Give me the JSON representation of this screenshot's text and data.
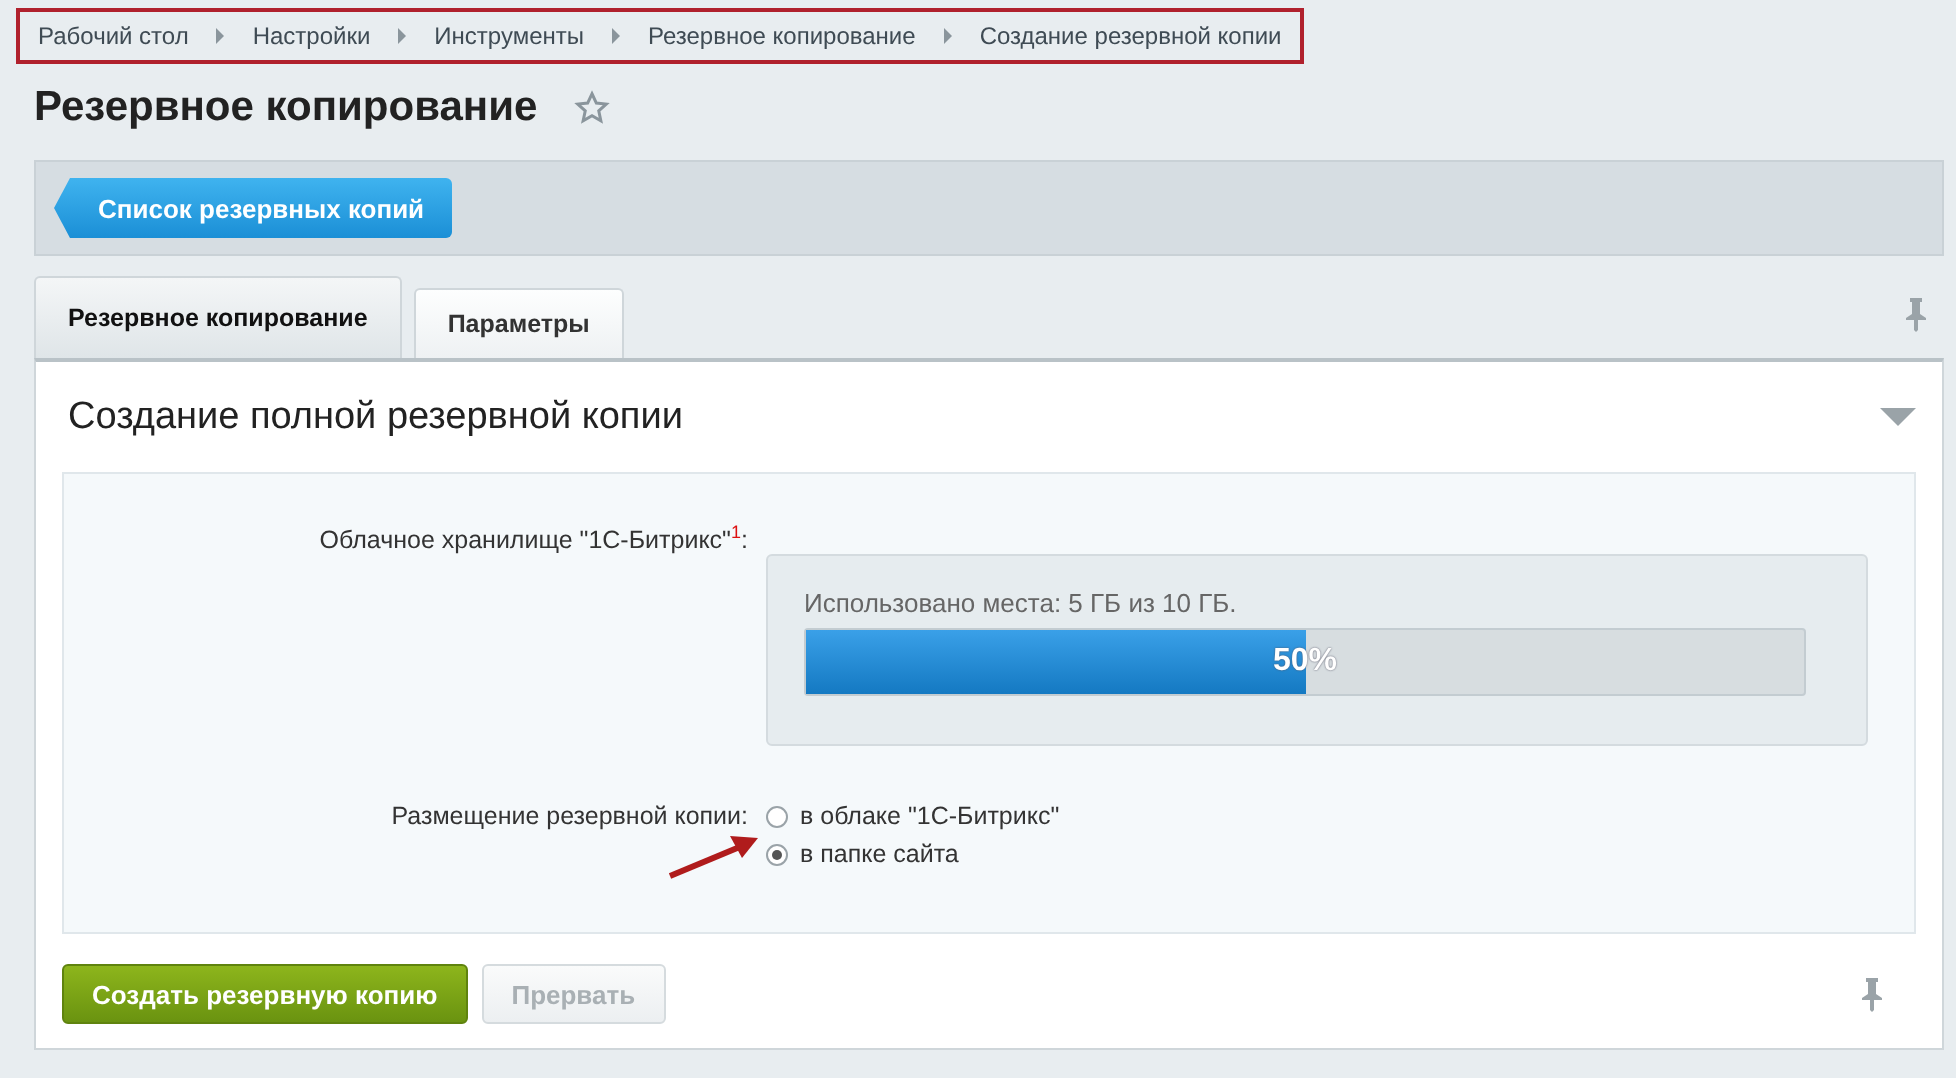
{
  "breadcrumbs": [
    "Рабочий стол",
    "Настройки",
    "Инструменты",
    "Резервное копирование",
    "Создание резервной копии"
  ],
  "title": "Резервное копирование",
  "toolbar": {
    "button": "Список резервных копий"
  },
  "tabs": [
    {
      "label": "Резервное копирование",
      "selected": true
    },
    {
      "label": "Параметры",
      "selected": false
    }
  ],
  "section": {
    "title": "Создание полной резервной копии",
    "expanded": true
  },
  "storage": {
    "label": "Облачное хранилище \"1С-Битрикс\"$^{1}$:",
    "usage": "Использовано места: 5 ГБ из 10 ГБ.",
    "level": 0.5,
    "reading": "50%"
  },
  "placement": {
    "label": "Размещение резервной копии:",
    "options": [
      {
        "label": "в облаке \"1С-Битрикс\"",
        "selected": false
      },
      {
        "label": "в папке сайта",
        "selected": true
      }
    ]
  },
  "buttons": [
    {
      "label": "Создать резервную копию",
      "disabled": false
    },
    {
      "label": "Прервать",
      "disabled": true
    }
  ]
}
